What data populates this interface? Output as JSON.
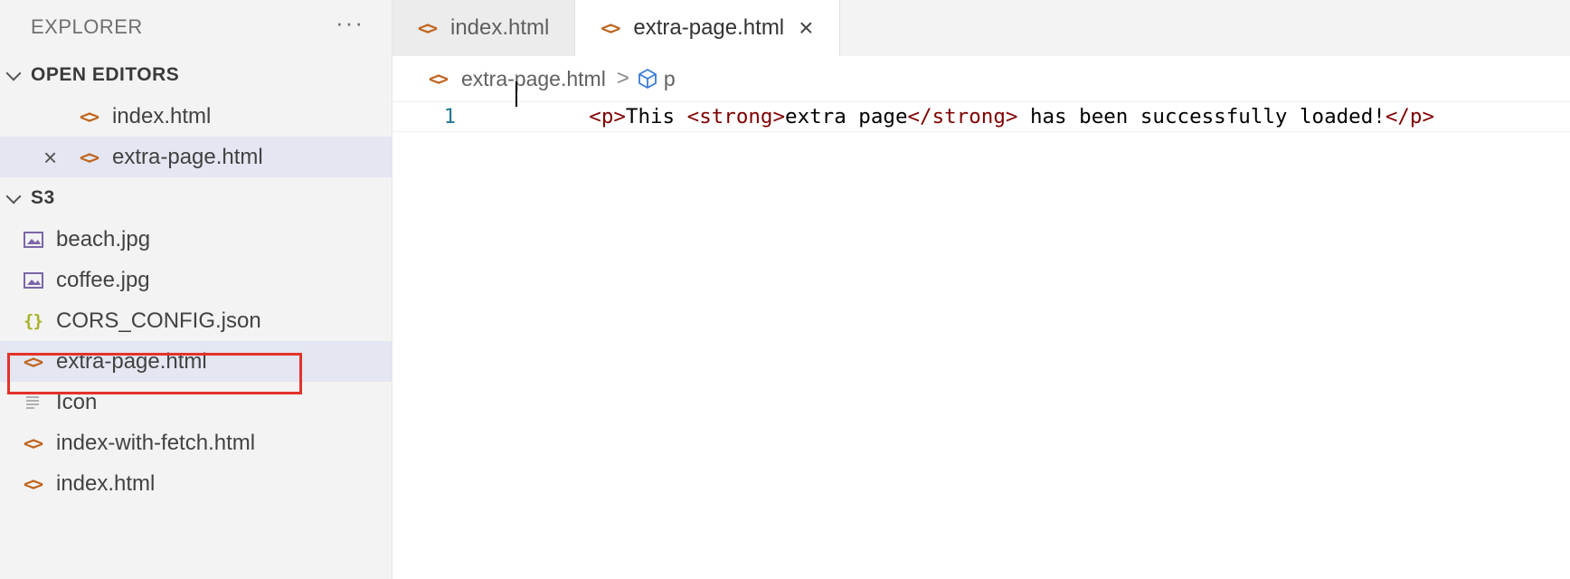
{
  "explorer": {
    "title": "EXPLORER",
    "more_icon": "···"
  },
  "open_editors": {
    "title": "OPEN EDITORS",
    "items": [
      {
        "label": "index.html",
        "icon": "html-icon",
        "selected": false
      },
      {
        "label": "extra-page.html",
        "icon": "html-icon",
        "selected": true
      }
    ]
  },
  "folder": {
    "title": "S3",
    "files": [
      {
        "label": "beach.jpg",
        "icon": "image-icon"
      },
      {
        "label": "coffee.jpg",
        "icon": "image-icon"
      },
      {
        "label": "CORS_CONFIG.json",
        "icon": "json-icon"
      },
      {
        "label": "extra-page.html",
        "icon": "html-icon",
        "highlighted": true
      },
      {
        "label": "Icon",
        "icon": "text-icon"
      },
      {
        "label": "index-with-fetch.html",
        "icon": "html-icon"
      },
      {
        "label": "index.html",
        "icon": "html-icon"
      }
    ]
  },
  "tabs": [
    {
      "label": "index.html",
      "active": false
    },
    {
      "label": "extra-page.html",
      "active": true
    }
  ],
  "breadcrumb": {
    "file": "extra-page.html",
    "separator": ">",
    "element": "p"
  },
  "editor": {
    "lines": [
      {
        "number": "1",
        "tokens": [
          {
            "type": "tag",
            "text": "<p>"
          },
          {
            "type": "txt",
            "text": "This "
          },
          {
            "type": "tag",
            "text": "<strong>"
          },
          {
            "type": "txt",
            "text": "extra page"
          },
          {
            "type": "tag",
            "text": "</strong>"
          },
          {
            "type": "txt",
            "text": " has been successfully loaded!"
          },
          {
            "type": "tag",
            "text": "</p>"
          }
        ]
      }
    ]
  },
  "colors": {
    "html_icon": "#c0651f",
    "json_icon": "#a9b227",
    "tag": "#800000",
    "highlight_box": "#e3332b",
    "selected_row": "#e4e6f1"
  }
}
